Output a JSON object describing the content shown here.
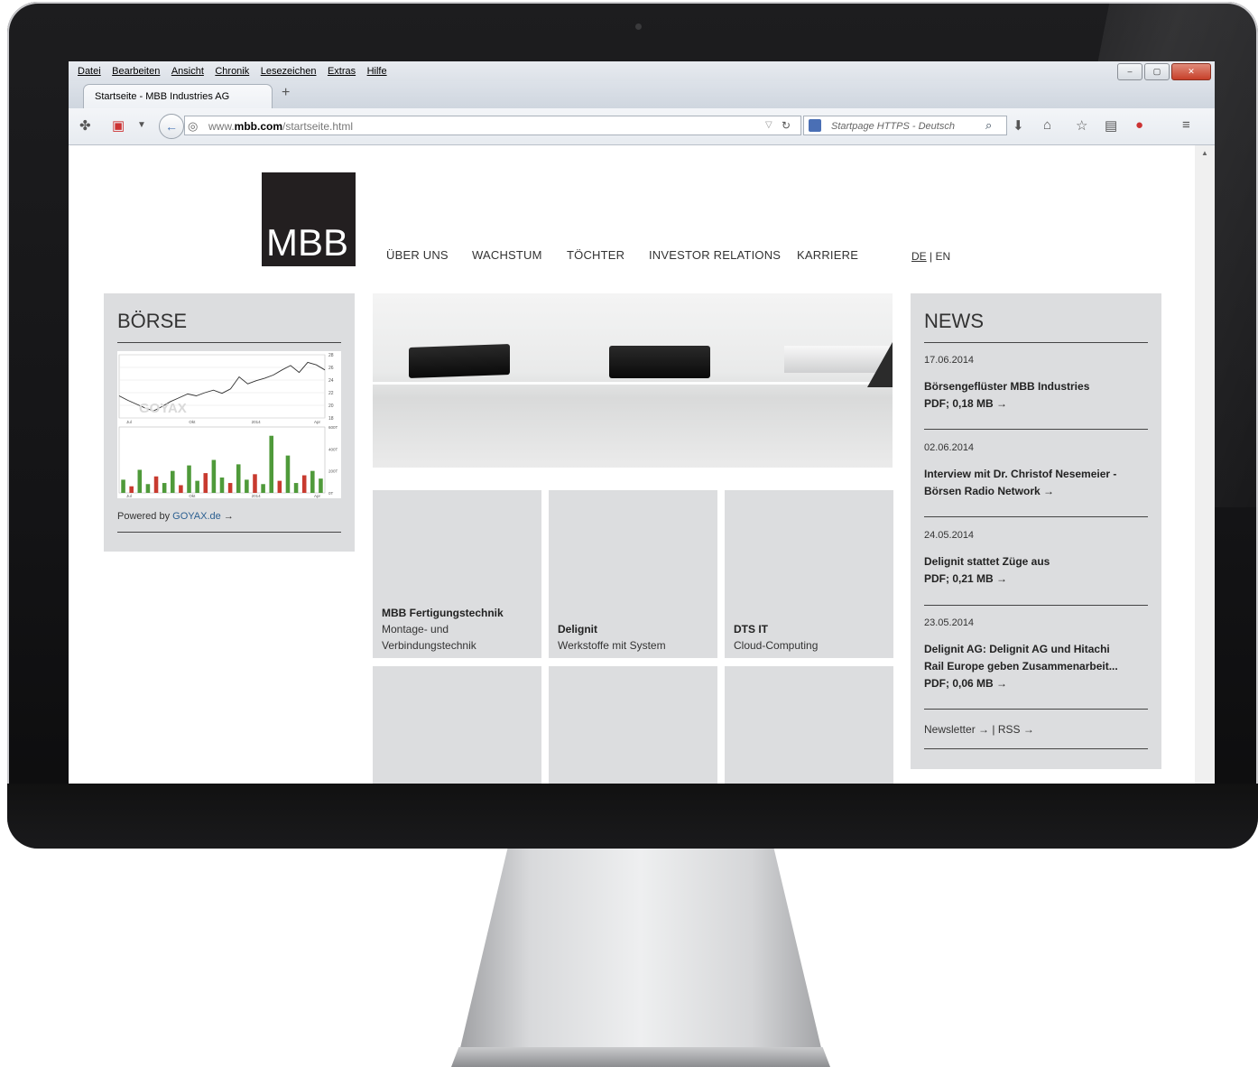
{
  "browser": {
    "menu": [
      "Datei",
      "Bearbeiten",
      "Ansicht",
      "Chronik",
      "Lesezeichen",
      "Extras",
      "Hilfe"
    ],
    "tab_title": "Startseite - MBB Industries AG",
    "new_tab": "+",
    "url_prefix": "www.",
    "url_domain": "mbb.com",
    "url_path": "/startseite.html",
    "search_placeholder": "Startpage HTTPS - Deutsch",
    "window_buttons": [
      "–",
      "▢",
      "✕"
    ]
  },
  "site": {
    "logo": "MBB",
    "nav": [
      "ÜBER UNS",
      "WACHSTUM",
      "TÖCHTER",
      "INVESTOR RELATIONS",
      "KARRIERE"
    ],
    "lang_de": "DE",
    "lang_sep": "|",
    "lang_en": "EN"
  },
  "boerse": {
    "title": "BÖRSE",
    "powered_prefix": "Powered by",
    "powered_link": "GOYAX.de",
    "arrow": "→",
    "watermark": "GOYAX"
  },
  "chart_data": {
    "type": "line",
    "title": "",
    "price": {
      "x": [
        "Jul",
        "Okt",
        "2014",
        "Apr"
      ],
      "ylim": [
        18,
        28
      ],
      "yticks": [
        18,
        20,
        22,
        24,
        26,
        28
      ],
      "values": [
        21.5,
        20.8,
        20.2,
        19.6,
        19.1,
        19.8,
        20.6,
        21.2,
        21.8,
        21.5,
        22.0,
        22.4,
        21.9,
        22.6,
        24.5,
        23.4,
        23.9,
        24.3,
        24.8,
        25.6,
        26.3,
        25.2,
        26.8,
        26.4,
        25.6
      ]
    },
    "volume": {
      "ylabels": [
        "600T",
        "400T",
        "200T",
        "0T"
      ],
      "ylim": [
        0,
        600
      ],
      "x": [
        "Jul",
        "Okt",
        "2014",
        "Apr"
      ],
      "values": [
        120,
        60,
        210,
        80,
        150,
        90,
        200,
        70,
        250,
        110,
        180,
        300,
        140,
        90,
        260,
        120,
        170,
        80,
        520,
        110,
        340,
        90,
        160,
        200,
        130
      ]
    }
  },
  "tiles": [
    {
      "name": "MBB Fertigungstechnik",
      "desc1": "Montage- und",
      "desc2": "Verbindungstechnik"
    },
    {
      "name": "Delignit",
      "desc1": "Werkstoffe mit System",
      "desc2": ""
    },
    {
      "name": "DTS IT",
      "desc1": "Cloud-Computing",
      "desc2": ""
    }
  ],
  "news": {
    "title": "NEWS",
    "items": [
      {
        "date": "17.06.2014",
        "line1": "Börsengeflüster MBB Industries",
        "line2": "PDF; 0,18 MB →",
        "line3": ""
      },
      {
        "date": "02.06.2014",
        "line1": "Interview mit Dr. Christof Nesemeier -",
        "line2": "Börsen Radio Network →",
        "line3": ""
      },
      {
        "date": "24.05.2014",
        "line1": "Delignit stattet Züge aus",
        "line2": "PDF; 0,21 MB →",
        "line3": ""
      },
      {
        "date": "23.05.2014",
        "line1": "Delignit AG: Delignit AG und Hitachi",
        "line2": "Rail Europe geben Zusammenarbeit...",
        "line3": "PDF; 0,06 MB →"
      }
    ],
    "newsletter": "Newsletter →",
    "sep": "|",
    "rss": "RSS →"
  }
}
